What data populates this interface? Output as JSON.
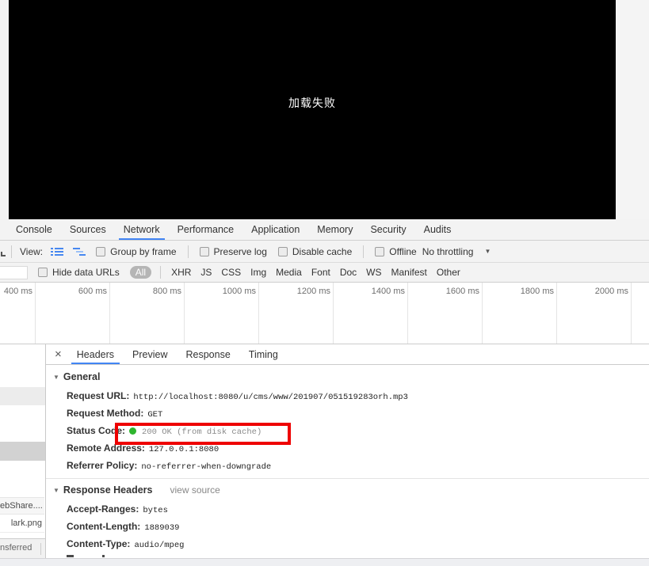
{
  "video": {
    "error_text": "加载失败"
  },
  "devtools": {
    "accent_color": "#4285f4",
    "main_tabs": [
      "Console",
      "Sources",
      "Network",
      "Performance",
      "Application",
      "Memory",
      "Security",
      "Audits"
    ],
    "active_main_tab": "Network",
    "toolbar": {
      "view_label": "View:",
      "group_by_frame": "Group by frame",
      "preserve_log": "Preserve log",
      "disable_cache": "Disable cache",
      "offline": "Offline",
      "throttling": "No throttling",
      "dropdown_icon": "▼"
    },
    "filter_bar": {
      "hide_data_urls": "Hide data URLs",
      "all_label": "All",
      "types": [
        "XHR",
        "JS",
        "CSS",
        "Img",
        "Media",
        "Font",
        "Doc",
        "WS",
        "Manifest",
        "Other"
      ]
    },
    "timeline": {
      "ticks": [
        "400 ms",
        "600 ms",
        "800 ms",
        "1000 ms",
        "1200 ms",
        "1400 ms",
        "1600 ms",
        "1800 ms",
        "2000 ms"
      ]
    },
    "request_list": {
      "items": [
        "ebShare....",
        "lark.png"
      ],
      "summary_partial": "nsferred"
    },
    "detail": {
      "close_icon": "×",
      "disclosure_icon": "▼",
      "tabs": [
        "Headers",
        "Preview",
        "Response",
        "Timing"
      ],
      "active_tab": "Headers",
      "annotation_color": "#ee0000",
      "general": {
        "title": "General",
        "status_dot_color": "#2eb52e",
        "rows": [
          {
            "label": "Request URL:",
            "value": "http://localhost:8080/u/cms/www/201907/051519283orh.mp3"
          },
          {
            "label": "Request Method:",
            "value": "GET"
          },
          {
            "label": "Status Code:",
            "value": "200 OK (from disk cache)"
          },
          {
            "label": "Remote Address:",
            "value": "127.0.0.1:8080"
          },
          {
            "label": "Referrer Policy:",
            "value": "no-referrer-when-downgrade"
          }
        ]
      },
      "response_headers": {
        "title": "Response Headers",
        "view_source_label": "view source",
        "rows": [
          {
            "label": "Accept-Ranges:",
            "value": "bytes"
          },
          {
            "label": "Content-Length:",
            "value": "1889039"
          },
          {
            "label": "Content-Type:",
            "value": "audio/mpeg"
          }
        ]
      }
    }
  }
}
